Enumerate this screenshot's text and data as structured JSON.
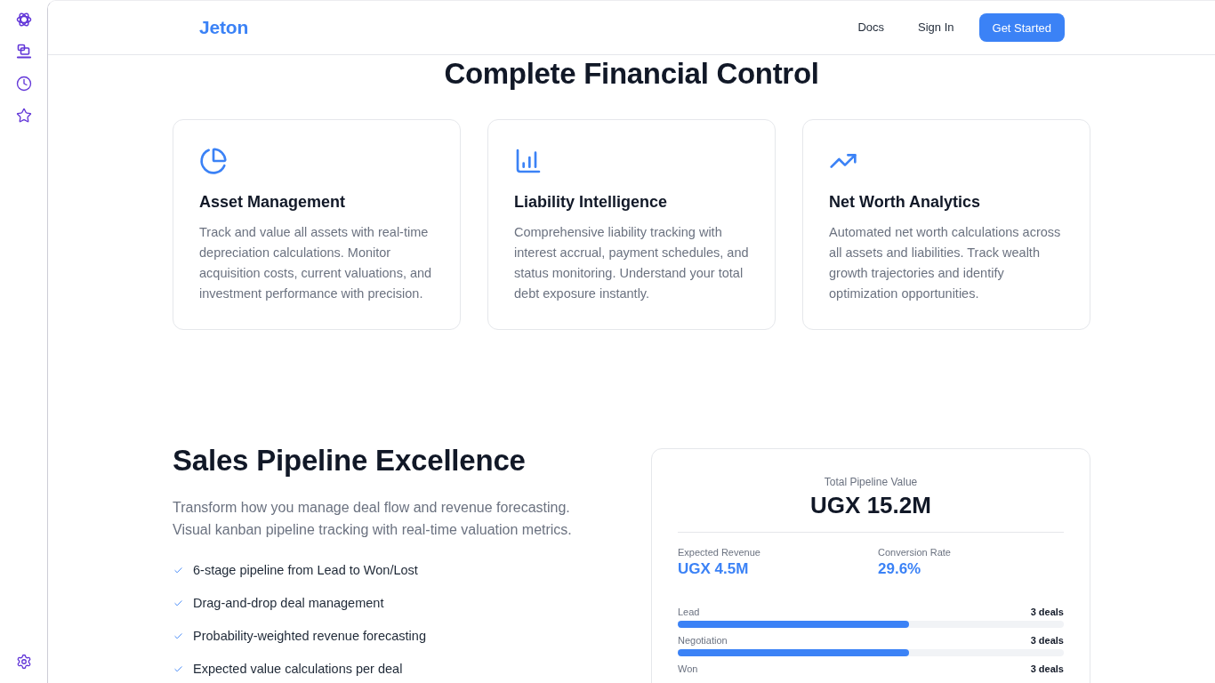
{
  "header": {
    "logo": "Jeton",
    "nav_links": [
      "Docs",
      "Sign In"
    ],
    "cta_button": "Get Started"
  },
  "features": {
    "heading": "Complete Financial Control",
    "cards": [
      {
        "title": "Asset Management",
        "description": "Track and value all assets with real-time depreciation calculations. Monitor acquisition costs, current valuations, and investment performance with precision."
      },
      {
        "title": "Liability Intelligence",
        "description": "Comprehensive liability tracking with interest accrual, payment schedules, and status monitoring. Understand your total debt exposure instantly."
      },
      {
        "title": "Net Worth Analytics",
        "description": "Automated net worth calculations across all assets and liabilities. Track wealth growth trajectories and identify optimization opportunities."
      }
    ]
  },
  "pipeline": {
    "title": "Sales Pipeline Excellence",
    "description": "Transform how you manage deal flow and revenue forecasting. Visual kanban pipeline tracking with real-time valuation metrics.",
    "features": [
      "6-stage pipeline from Lead to Won/Lost",
      "Drag-and-drop deal management",
      "Probability-weighted revenue forecasting",
      "Expected value calculations per deal"
    ],
    "summary_card": {
      "total_label": "Total Pipeline Value",
      "total_value": "UGX 15.2M",
      "metrics": [
        {
          "label": "Expected Revenue",
          "value": "UGX 4.5M"
        },
        {
          "label": "Conversion Rate",
          "value": "29.6%"
        }
      ],
      "stages": [
        {
          "name": "Lead",
          "count": "3 deals",
          "level": 0.6
        },
        {
          "name": "Negotiation",
          "count": "3 deals",
          "level": 0.6
        },
        {
          "name": "Won",
          "count": "3 deals"
        }
      ]
    }
  }
}
